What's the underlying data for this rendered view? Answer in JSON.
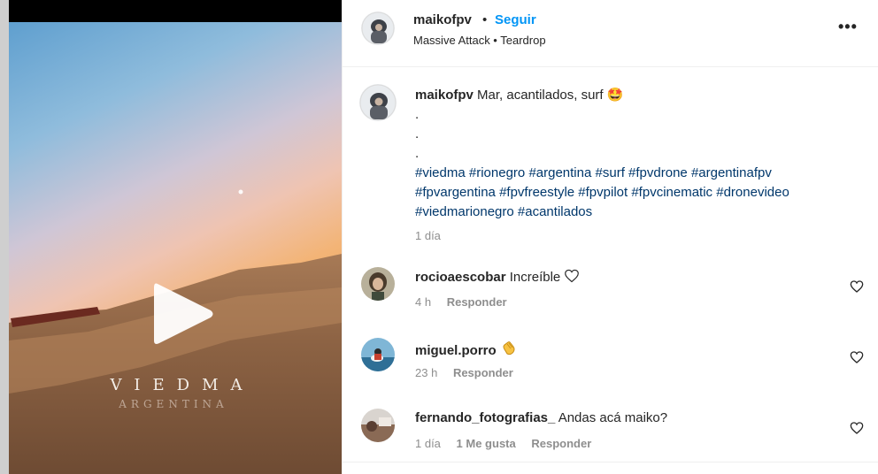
{
  "post": {
    "username": "maikofpv",
    "separator": "•",
    "follow_label": "Seguir",
    "audio": "Massive Attack • Teardrop",
    "more_label": "•••"
  },
  "media": {
    "overlay_title": "VIEDMA",
    "overlay_subtitle": "ARGENTINA",
    "play_icon": "play-icon"
  },
  "caption": {
    "username": "maikofpv",
    "text": "Mar, acantilados, surf",
    "emoji": "🤩",
    "dots": [
      ".",
      ".",
      "."
    ],
    "hashtags_line1": [
      "#viedma",
      "#rionegro",
      "#argentina",
      "#surf",
      "#fpvdrone",
      "#argentinafpv"
    ],
    "hashtags_line2": [
      "#fpvargentina",
      "#fpvfreestyle",
      "#fpvpilot",
      "#fpvcinematic",
      "#dronevideo"
    ],
    "hashtags_line3": [
      "#viedmarionegro",
      "#acantilados"
    ],
    "time": "1 día"
  },
  "comments": [
    {
      "username": "rocioaescobar",
      "text": "Increíble",
      "time": "4 h",
      "likes": "",
      "reply_label": "Responder"
    },
    {
      "username": "miguel.porro",
      "text": "",
      "time": "23 h",
      "likes": "",
      "reply_label": "Responder"
    },
    {
      "username": "fernando_fotografias_",
      "text": "Andas acá maiko?",
      "time": "1 día",
      "likes": "1 Me gusta",
      "reply_label": "Responder"
    }
  ],
  "colors": {
    "link": "#0095f6",
    "hashtag": "#00376b",
    "muted": "#8e8e8e",
    "text": "#262626"
  }
}
